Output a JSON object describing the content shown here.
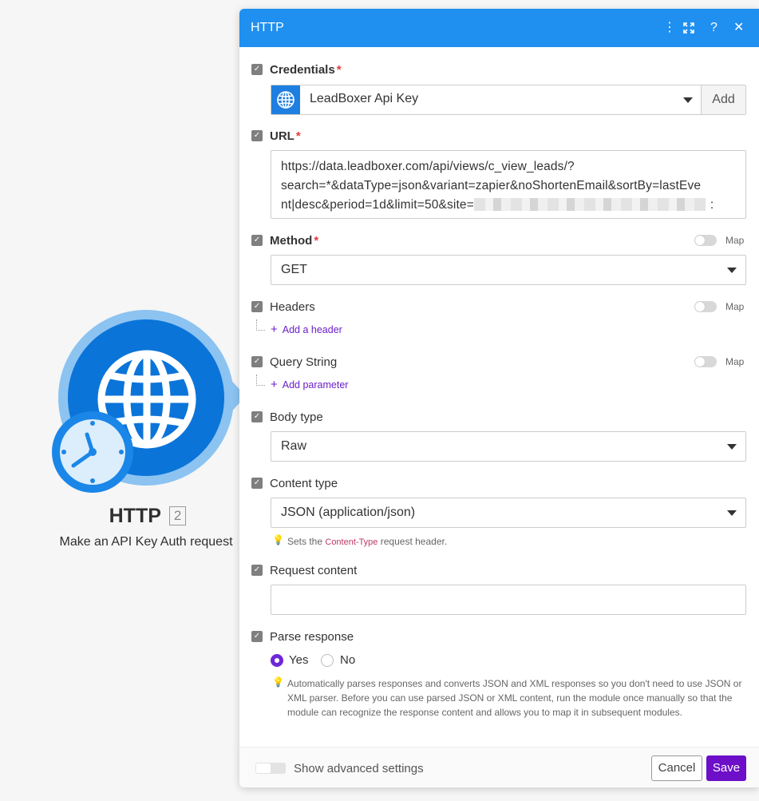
{
  "module": {
    "title": "HTTP",
    "badge": "2",
    "subtitle": "Make an API Key Auth request"
  },
  "panel": {
    "title": "HTTP",
    "icons": [
      "more-vertical-icon",
      "expand-icon",
      "help-icon",
      "close-icon"
    ]
  },
  "fields": {
    "credentials": {
      "label": "Credentials",
      "required": "*",
      "value": "LeadBoxer Api Key",
      "add_label": "Add"
    },
    "url": {
      "label": "URL",
      "required": "*",
      "line1": "https://data.leadboxer.com/api/views/c_view_leads/?",
      "line2": "search=*&dataType=json&variant=zapier&noShortenEmail&sortBy=lastEve",
      "line3": "nt|desc&period=1d&limit=50&site=",
      "line3_end": ":"
    },
    "method": {
      "label": "Method",
      "required": "*",
      "value": "GET",
      "map_label": "Map"
    },
    "headers": {
      "label": "Headers",
      "map_label": "Map",
      "add_label": "Add a header"
    },
    "query_string": {
      "label": "Query String",
      "map_label": "Map",
      "add_label": "Add parameter"
    },
    "body_type": {
      "label": "Body type",
      "value": "Raw"
    },
    "content_type": {
      "label": "Content type",
      "value": "JSON (application/json)",
      "hint_prefix": "Sets the",
      "hint_code": "Content-Type",
      "hint_suffix": "request header."
    },
    "request_content": {
      "label": "Request content",
      "value": ""
    },
    "parse_response": {
      "label": "Parse response",
      "options": [
        "Yes",
        "No"
      ],
      "selected": "Yes",
      "hint": "Automatically parses responses and converts JSON and XML responses so you don't need to use JSON or XML parser. Before you can use parsed JSON or XML content, run the module once manually so that the module can recognize the response content and allows you to map it in subsequent modules."
    }
  },
  "footer": {
    "advanced_label": "Show advanced settings",
    "cancel_label": "Cancel",
    "save_label": "Save"
  },
  "colors": {
    "header_blue": "#1f8ff0",
    "module_blue": "#0b74d9",
    "accent_purple": "#6d0ec8",
    "required_red": "#e23b3b"
  }
}
